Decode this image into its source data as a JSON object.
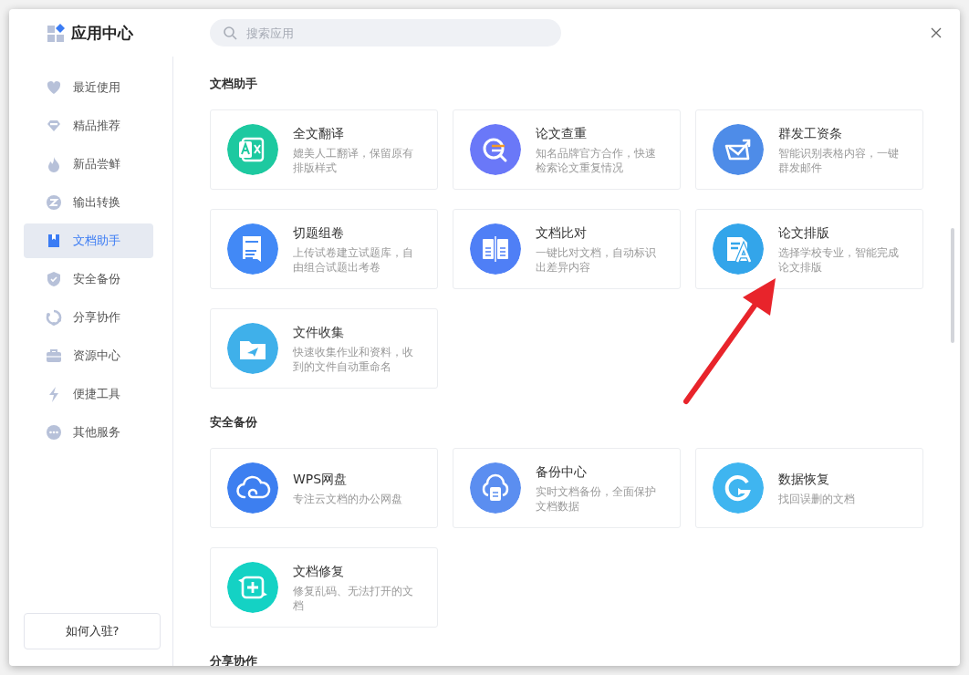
{
  "app": {
    "title": "应用中心"
  },
  "search": {
    "placeholder": "搜索应用"
  },
  "sidebar": {
    "items": [
      {
        "label": "最近使用",
        "selected": false
      },
      {
        "label": "精品推荐",
        "selected": false
      },
      {
        "label": "新品尝鲜",
        "selected": false
      },
      {
        "label": "输出转换",
        "selected": false
      },
      {
        "label": "文档助手",
        "selected": true
      },
      {
        "label": "安全备份",
        "selected": false
      },
      {
        "label": "分享协作",
        "selected": false
      },
      {
        "label": "资源中心",
        "selected": false
      },
      {
        "label": "便捷工具",
        "selected": false
      },
      {
        "label": "其他服务",
        "selected": false
      }
    ],
    "join_button": "如何入驻?"
  },
  "sections": [
    {
      "title": "文档助手",
      "cards": [
        {
          "title": "全文翻译",
          "description": "媲美人工翻译，保留原有排版样式",
          "color": "#1dc9a0"
        },
        {
          "title": "论文查重",
          "description": "知名品牌官方合作，快速检索论文重复情况",
          "color": "#6a78f8"
        },
        {
          "title": "群发工资条",
          "description": "智能识别表格内容，一键群发邮件",
          "color": "#4e8ce8"
        },
        {
          "title": "切题组卷",
          "description": "上传试卷建立试题库，自由组合试题出考卷",
          "color": "#4289f6"
        },
        {
          "title": "文档比对",
          "description": "一键比对文档，自动标识出差异内容",
          "color": "#4f7ff6"
        },
        {
          "title": "论文排版",
          "description": "选择学校专业，智能完成论文排版",
          "color": "#33a5ea"
        },
        {
          "title": "文件收集",
          "description": "快速收集作业和资料，收到的文件自动重命名",
          "color": "#3fb0ea"
        }
      ]
    },
    {
      "title": "安全备份",
      "cards": [
        {
          "title": "WPS网盘",
          "description": "专注云文档的办公网盘",
          "color": "#3d7ff0"
        },
        {
          "title": "备份中心",
          "description": "实时文档备份，全面保护文档数据",
          "color": "#5b8ef0"
        },
        {
          "title": "数据恢复",
          "description": "找回误删的文档",
          "color": "#3fb5f0"
        },
        {
          "title": "文档修复",
          "description": "修复乱码、无法打开的文档",
          "color": "#14d2c4"
        }
      ]
    },
    {
      "title": "分享协作"
    }
  ]
}
